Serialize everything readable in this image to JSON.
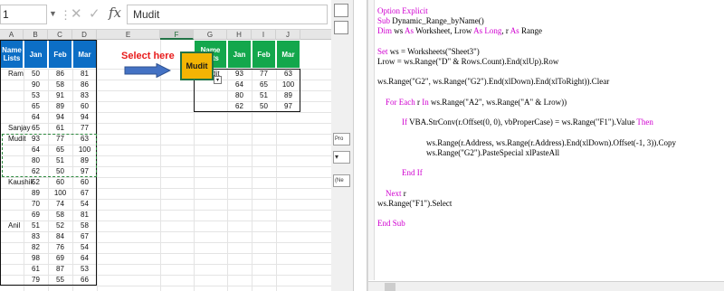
{
  "formula_bar": {
    "name_box": "1",
    "value": "Mudit",
    "cancel_icon": "✕",
    "enter_icon": "✓",
    "fx_label": "fx"
  },
  "sheet": {
    "columns": [
      "A",
      "B",
      "C",
      "D",
      "E",
      "F",
      "G",
      "H",
      "I",
      "J"
    ],
    "selected_column": "F",
    "source_headers": [
      "Name Lists",
      "Jan",
      "Feb",
      "Mar"
    ],
    "source_rows": [
      [
        "Ram",
        "50",
        "86",
        "81"
      ],
      [
        "",
        "90",
        "58",
        "86"
      ],
      [
        "",
        "53",
        "91",
        "83"
      ],
      [
        "",
        "65",
        "89",
        "60"
      ],
      [
        "",
        "64",
        "94",
        "94"
      ],
      [
        "Sanjay",
        "65",
        "61",
        "77"
      ],
      [
        "Mudit",
        "93",
        "77",
        "63"
      ],
      [
        "",
        "64",
        "65",
        "100"
      ],
      [
        "",
        "80",
        "51",
        "89"
      ],
      [
        "",
        "62",
        "50",
        "97"
      ],
      [
        "Kaushik",
        "52",
        "60",
        "60"
      ],
      [
        "",
        "89",
        "100",
        "67"
      ],
      [
        "",
        "70",
        "74",
        "54"
      ],
      [
        "",
        "69",
        "58",
        "81"
      ],
      [
        "Anil",
        "51",
        "52",
        "58"
      ],
      [
        "",
        "83",
        "84",
        "67"
      ],
      [
        "",
        "82",
        "76",
        "54"
      ],
      [
        "",
        "98",
        "69",
        "64"
      ],
      [
        "",
        "61",
        "87",
        "53"
      ],
      [
        "",
        "79",
        "55",
        "66"
      ]
    ],
    "select_label": "Select here",
    "selected_name": "Mudit",
    "output_headers": [
      "Name Lists",
      "Jan",
      "Feb",
      "Mar"
    ],
    "output_rows": [
      [
        "Mudit",
        "93",
        "77",
        "63"
      ],
      [
        "",
        "64",
        "65",
        "100"
      ],
      [
        "",
        "80",
        "51",
        "89"
      ],
      [
        "",
        "62",
        "50",
        "97"
      ]
    ]
  },
  "vbe_sidebar": {
    "dropdown_1": "Pro",
    "dropdown_2": "(Ne"
  },
  "code": {
    "lines": [
      [
        [
          "kw",
          "Option Explicit"
        ]
      ],
      [
        [
          "kw",
          "Sub"
        ],
        [
          "t",
          " Dynamic_Range_byName()"
        ]
      ],
      [
        [
          "kw",
          "Dim"
        ],
        [
          "t",
          " ws "
        ],
        [
          "kw",
          "As"
        ],
        [
          "t",
          " Worksheet, Lrow "
        ],
        [
          "kw",
          "As"
        ],
        [
          "t",
          " "
        ],
        [
          "kw",
          "Long"
        ],
        [
          "t",
          ", r "
        ],
        [
          "kw",
          "As"
        ],
        [
          "t",
          " Range"
        ]
      ],
      [],
      [
        [
          "kw",
          "Set"
        ],
        [
          "t",
          " ws = Worksheets(\"Sheet3\")"
        ]
      ],
      [
        [
          "t",
          "Lrow = ws.Range(\"D\" & Rows.Count).End(xlUp).Row"
        ]
      ],
      [],
      [
        [
          "t",
          "ws.Range(\"G2\", ws.Range(\"G2\").End(xlDown).End(xlToRight)).Clear"
        ]
      ],
      [],
      [
        [
          "t",
          "    "
        ],
        [
          "kw",
          "For Each"
        ],
        [
          "t",
          " r "
        ],
        [
          "kw",
          "In"
        ],
        [
          "t",
          " ws.Range(\"A2\", ws.Range(\"A\" & Lrow))"
        ]
      ],
      [],
      [
        [
          "t",
          "            "
        ],
        [
          "kw",
          "If"
        ],
        [
          "t",
          " VBA.StrConv(r.Offset(0, 0), vbProperCase) = ws.Range(\"F1\").Value "
        ],
        [
          "kw",
          "Then"
        ]
      ],
      [],
      [
        [
          "t",
          "                        ws.Range(r.Address, ws.Range(r.Address).End(xlDown).Offset(-1, 3)).Copy"
        ]
      ],
      [
        [
          "t",
          "                        ws.Range(\"G2\").PasteSpecial xlPasteAll"
        ]
      ],
      [],
      [
        [
          "t",
          "            "
        ],
        [
          "kw",
          "End If"
        ]
      ],
      [],
      [
        [
          "t",
          "    "
        ],
        [
          "kw",
          "Next"
        ],
        [
          "t",
          " r"
        ]
      ],
      [
        [
          "t",
          "ws.Range(\"F1\").Select"
        ]
      ],
      [],
      [
        [
          "kw",
          "End Sub"
        ]
      ]
    ]
  },
  "colors": {
    "source_header": "#0c6ec5",
    "output_header": "#13a74c",
    "selected_cell": "#f3b404",
    "annotation": "#e81b1b",
    "keyword": "#d000d0"
  }
}
